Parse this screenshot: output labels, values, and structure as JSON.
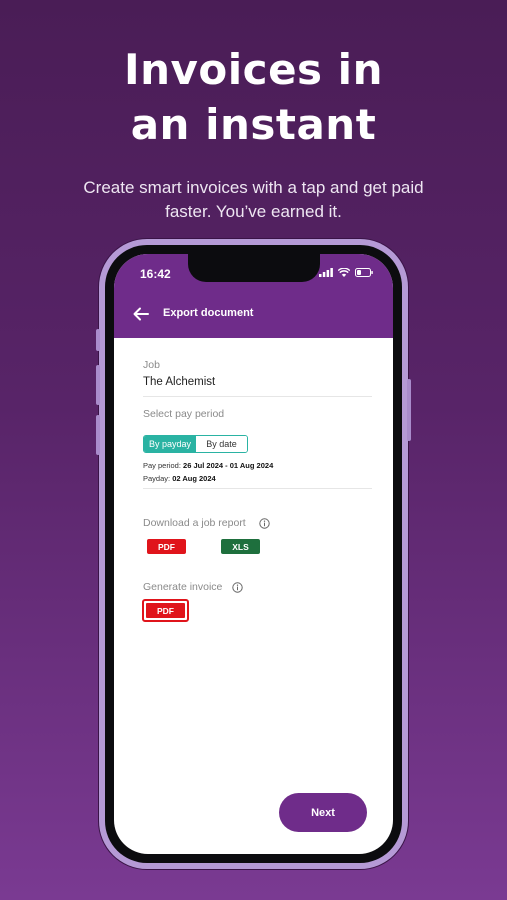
{
  "promo": {
    "headline_line1": "Invoices in",
    "headline_line2": "an instant",
    "subtitle": "Create smart invoices with a tap and get paid faster. You’ve earned it."
  },
  "status_bar": {
    "time": "16:42"
  },
  "app_bar": {
    "title": "Export document",
    "back_icon": "arrow-left-icon"
  },
  "job": {
    "label": "Job",
    "value": "The Alchemist"
  },
  "pay_period": {
    "label": "Select pay period",
    "options": [
      "By payday",
      "By date"
    ],
    "selected": "By payday",
    "period_label": "Pay period:",
    "period_value": "26 Jul 2024 - 01 Aug 2024",
    "payday_label": "Payday:",
    "payday_value": "02 Aug 2024"
  },
  "job_report": {
    "label": "Download a job report",
    "pdf": "PDF",
    "xls": "XLS"
  },
  "invoice": {
    "label": "Generate invoice",
    "pdf": "PDF"
  },
  "next_button": "Next",
  "colors": {
    "brand_purple": "#6f2c8a",
    "background": "#4a1d56",
    "accent_teal": "#2ab3a3",
    "pdf_red": "#e0141b",
    "xls_green": "#1e6f3d"
  }
}
